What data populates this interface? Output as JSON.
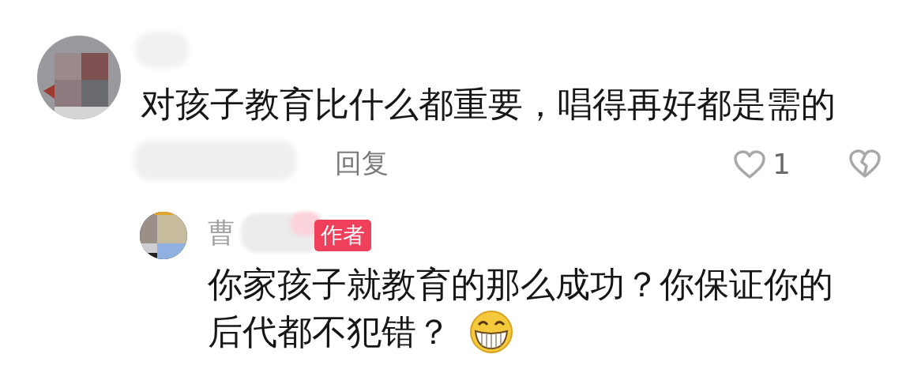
{
  "comment": {
    "text": "对孩子教育比什么都重要，唱得再好都是需的",
    "reply_label": "回复",
    "like_count": "1",
    "liked": false,
    "replies": [
      {
        "author": "曹",
        "author_badge": "作者",
        "text_lines": [
          "你家孩子就教育的那么成功？你保证你的",
          "后代都不犯错？"
        ]
      }
    ]
  }
}
